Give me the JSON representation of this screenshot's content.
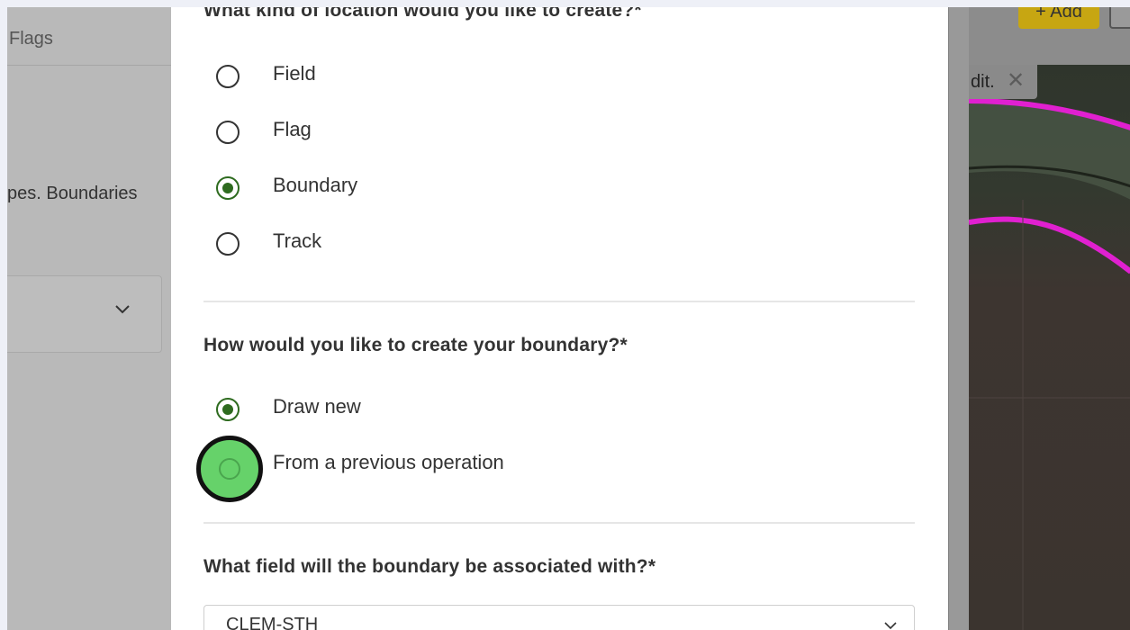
{
  "background": {
    "left_tab_label": "Flags",
    "left_description": "pes. Boundaries",
    "add_button_label": "+ Add",
    "map_chip_text": "dit.",
    "map_chip_close_icon": "close-icon"
  },
  "modal": {
    "location_question": "What kind of location would you like to create?*",
    "location_options": [
      {
        "label": "Field",
        "checked": false
      },
      {
        "label": "Flag",
        "checked": false
      },
      {
        "label": "Boundary",
        "checked": true
      },
      {
        "label": "Track",
        "checked": false
      }
    ],
    "boundary_question": "How would you like to create your boundary?*",
    "boundary_options": [
      {
        "label": "Draw new",
        "checked": true
      },
      {
        "label": "From a previous operation",
        "checked": false
      }
    ],
    "field_question": "What field will the boundary be associated with?*",
    "field_select_value": "CLEM-STH"
  },
  "colors": {
    "accent_green": "#2e6b1f",
    "click_highlight": "#66d26a",
    "add_button": "#c7a612",
    "boundary_line": "#e020d0"
  }
}
